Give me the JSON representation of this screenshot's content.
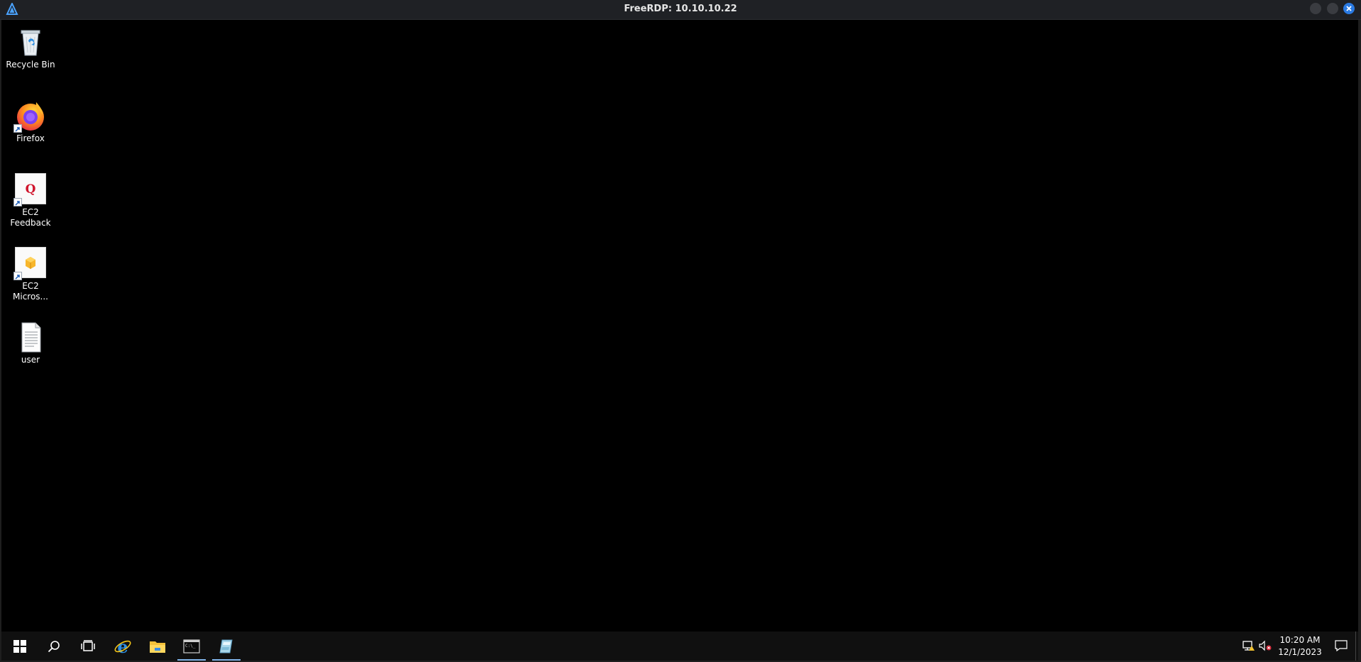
{
  "window": {
    "title": "FreeRDP: 10.10.10.22"
  },
  "desktop": {
    "icons": [
      {
        "label": "Recycle Bin",
        "icon": "recycle-bin-icon"
      },
      {
        "label": "Firefox",
        "icon": "firefox-icon"
      },
      {
        "label": "EC2 Feedback",
        "icon": "ec2-feedback-icon"
      },
      {
        "label": "EC2 Micros...",
        "icon": "ec2-microsoft-icon"
      },
      {
        "label": "user",
        "icon": "text-file-icon"
      }
    ]
  },
  "taskbar": {
    "buttons": [
      {
        "icon": "windows-start-icon"
      },
      {
        "icon": "search-icon"
      },
      {
        "icon": "task-view-icon"
      },
      {
        "icon": "internet-explorer-icon"
      },
      {
        "icon": "file-explorer-icon"
      },
      {
        "icon": "command-prompt-icon",
        "active": true
      },
      {
        "icon": "app-icon",
        "active": true
      }
    ],
    "clock": {
      "time": "10:20 AM",
      "date": "12/1/2023"
    }
  },
  "colors": {
    "desktop_bg": "#000000",
    "taskbar_bg": "#101010",
    "titlebar_bg": "#1f2125",
    "close_button": "#2a7ae2",
    "active_indicator": "#7fb3e8"
  }
}
